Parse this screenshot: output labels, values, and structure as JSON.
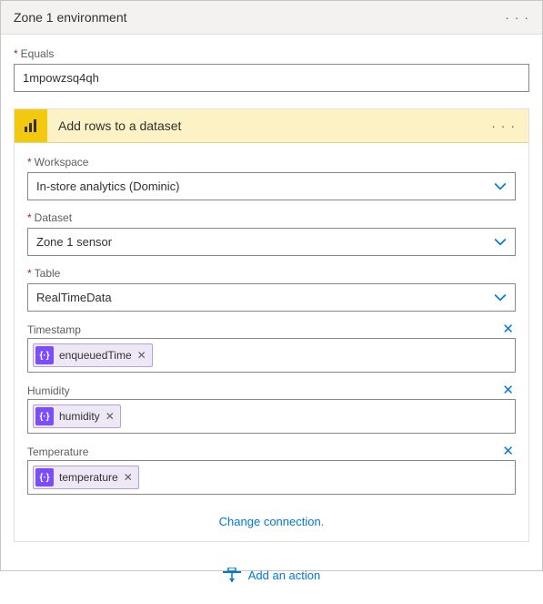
{
  "header": {
    "title": "Zone 1 environment"
  },
  "condition": {
    "label": "Equals",
    "value": "1mpowzsq4qh"
  },
  "action": {
    "title": "Add rows to a dataset",
    "fields": {
      "workspace": {
        "label": "Workspace",
        "value": "In-store analytics (Dominic)"
      },
      "dataset": {
        "label": "Dataset",
        "value": "Zone 1 sensor"
      },
      "table": {
        "label": "Table",
        "value": "RealTimeData"
      },
      "timestamp": {
        "label": "Timestamp",
        "token": "enqueuedTime"
      },
      "humidity": {
        "label": "Humidity",
        "token": "humidity"
      },
      "temperature": {
        "label": "Temperature",
        "token": "temperature"
      }
    },
    "change_connection": "Change connection."
  },
  "footer": {
    "add_action": "Add an action"
  }
}
